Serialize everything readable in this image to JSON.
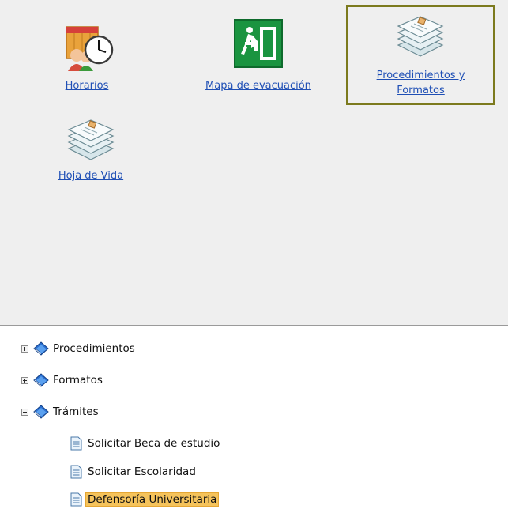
{
  "tiles": [
    {
      "label": "Horarios",
      "icon": "schedule-people-clock-icon"
    },
    {
      "label": "Mapa de evacuación",
      "icon": "emergency-exit-icon"
    },
    {
      "label_line1": "Procedimientos y",
      "label_line2": "Formatos",
      "icon": "documents-stack-icon",
      "selected": true
    },
    {
      "label": "Hoja de Vida",
      "icon": "documents-stack-icon"
    }
  ],
  "tree": {
    "folders": [
      {
        "label": "Procedimientos",
        "state": "collapsed",
        "icon": "book-icon"
      },
      {
        "label": "Formatos",
        "state": "collapsed",
        "icon": "book-icon"
      },
      {
        "label": "Trámites",
        "state": "expanded",
        "icon": "book-icon"
      }
    ],
    "tramites_children": [
      {
        "label": "Solicitar Beca de estudio",
        "icon": "document-icon"
      },
      {
        "label": "Solicitar Escolaridad",
        "icon": "document-icon"
      },
      {
        "label": "Defensoría Universitaria",
        "icon": "document-icon",
        "selected": true
      }
    ]
  },
  "colors": {
    "link": "#1f4fb5",
    "selected_tile_border": "#7c7a1e",
    "selected_node_bg": "#f5c35b",
    "panel_bg": "#efefef"
  }
}
